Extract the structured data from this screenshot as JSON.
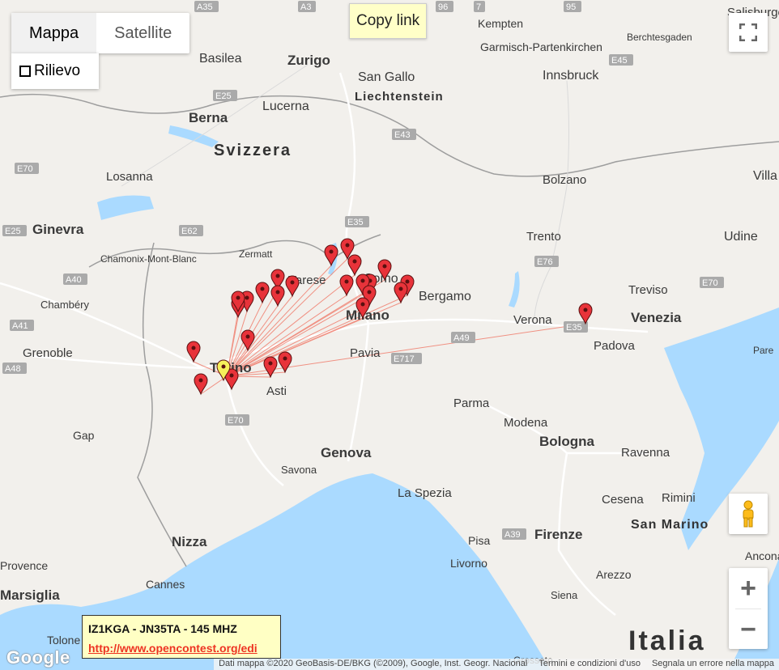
{
  "controls": {
    "map_type_active": "Mappa",
    "map_type_satellite": "Satellite",
    "terrain_label": "Rilievo",
    "copy_link": "Copy link"
  },
  "infobox": {
    "title": "IZ1KGA - JN35TA - 145 MHZ",
    "link": "http://www.opencontest.org/edi"
  },
  "attribution": {
    "data": "Dati mappa ©2020 GeoBasis-DE/BKG (©2009), Google, Inst. Geogr. Nacional",
    "terms": "Termini e condizioni d'uso",
    "report": "Segnala un errore nella mappa",
    "logo": "Google"
  },
  "colors": {
    "marker": "#e8333a",
    "home_marker": "#f5f05a",
    "line": "#f08070",
    "water": "#aadaff",
    "land": "#f2f0ec"
  },
  "labels": {
    "countries": [
      "Svizzera",
      "Liechtenstein",
      "Italia",
      "San Marino"
    ],
    "cities": [
      "Basilea",
      "Zurigo",
      "San Gallo",
      "Kempten",
      "Salisburgo",
      "Berchtesgaden",
      "Garmisch-Partenkirchen",
      "Innsbruck",
      "Berna",
      "Lucerna",
      "Losanna",
      "Ginevra",
      "Bolzano",
      "Trento",
      "Udine",
      "Villa",
      "Chamonix-Mont-Blanc",
      "Zermatt",
      "Varese",
      "Como",
      "Bergamo",
      "Chambéry",
      "Treviso",
      "Venezia",
      "Milano",
      "Verona",
      "Padova",
      "Grenoble",
      "Torino",
      "Pavia",
      "Asti",
      "Parma",
      "Gap",
      "Modena",
      "Bologna",
      "Ravenna",
      "Genova",
      "Savona",
      "La Spezia",
      "Cesena",
      "Rimini",
      "Pisa",
      "Firenze",
      "Nizza",
      "Livorno",
      "Arezzo",
      "Ancona",
      "Cannes",
      "Siena",
      "Marsiglia",
      "Tolone",
      "Grosseto",
      "Provence",
      "Pare"
    ],
    "roads": [
      "A35",
      "A3",
      "96",
      "7",
      "95",
      "E45",
      "E25",
      "E43",
      "E35",
      "E62",
      "E25",
      "A40",
      "A41",
      "A48",
      "A49",
      "E70",
      "E717",
      "E35",
      "E70",
      "E70",
      "A39",
      "E76",
      "E45"
    ]
  }
}
